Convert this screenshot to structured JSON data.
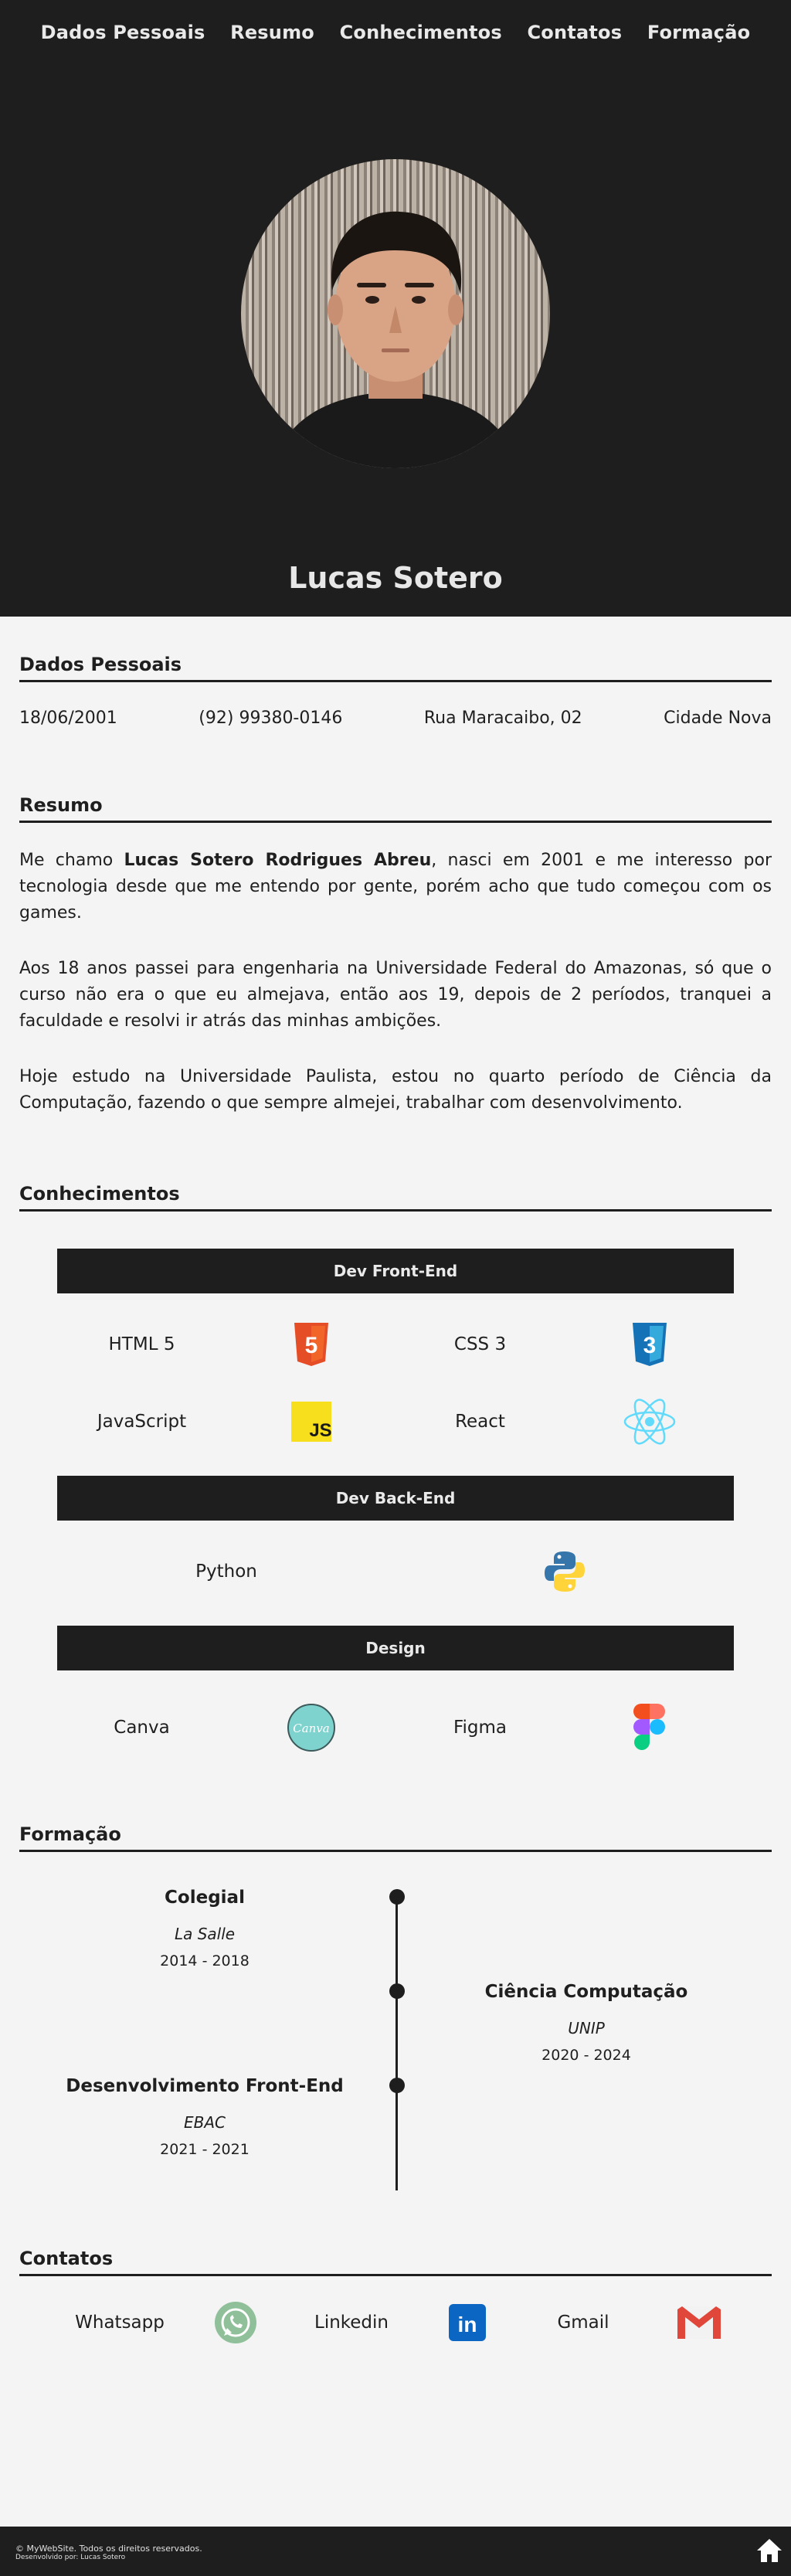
{
  "nav": {
    "items": [
      "Dados Pessoais",
      "Resumo",
      "Conhecimentos",
      "Contatos",
      "Formação"
    ]
  },
  "hero": {
    "name": "Lucas Sotero"
  },
  "personal": {
    "title": "Dados Pessoais",
    "birth": "18/06/2001",
    "phone": "(92) 99380-0146",
    "street": "Rua Maracaibo, 02",
    "district": "Cidade Nova"
  },
  "resume": {
    "title": "Resumo",
    "p1_before": "Me chamo ",
    "p1_bold": "Lucas Sotero Rodrigues Abreu",
    "p1_after": ", nasci em 2001 e me interesso por tecnologia desde que me entendo por gente, porém acho que tudo começou com os games.",
    "p2": "Aos 18 anos passei para engenharia na Universidade Federal do Amazonas, só que o curso não era o que eu almejava, então aos 19, depois de 2 períodos, tranquei a faculdade e resolvi ir atrás das minhas ambições.",
    "p3": "Hoje estudo na Universidade Paulista, estou no quarto período de Ciência da Computação, fazendo o que sempre almejei, trabalhar com desenvolvimento."
  },
  "skills": {
    "title": "Conhecimentos",
    "frontend": {
      "label": "Dev Front-End",
      "items": [
        "HTML 5",
        "CSS 3",
        "JavaScript",
        "React"
      ]
    },
    "backend": {
      "label": "Dev Back-End",
      "items": [
        "Python"
      ]
    },
    "design": {
      "label": "Design",
      "items": [
        "Canva",
        "Figma"
      ]
    },
    "icon_texts": {
      "js": "JS",
      "html_num": "5",
      "css_num": "3",
      "canva": "Canva"
    }
  },
  "education": {
    "title": "Formação",
    "entries": [
      {
        "title": "Colegial",
        "school": "La Salle",
        "years": "2014 - 2018"
      },
      {
        "title": "Ciência Computação",
        "school": "UNIP",
        "years": "2020 - 2024"
      },
      {
        "title": "Desenvolvimento Front-End",
        "school": "EBAC",
        "years": "2021 - 2021"
      }
    ]
  },
  "contacts": {
    "title": "Contatos",
    "items": [
      "Whatsapp",
      "Linkedin",
      "Gmail"
    ],
    "linkedin_glyph": "in"
  },
  "footer": {
    "line1": "© MyWebSite. Todos os direitos reservados.",
    "line2": "Desenvolvido por: Lucas Sotero"
  },
  "colors": {
    "dark": "#1e1e1e",
    "background": "#f4f4f4",
    "html_orange": "#e44d26",
    "css_blue": "#1572b6",
    "js_yellow": "#f7df1e",
    "react_cyan": "#61dafb",
    "linkedin_blue": "#0a66c2"
  },
  "icons": [
    "html5-icon",
    "css3-icon",
    "javascript-icon",
    "react-icon",
    "python-icon",
    "canva-icon",
    "figma-icon",
    "whatsapp-icon",
    "linkedin-icon",
    "gmail-icon",
    "home-icon"
  ]
}
